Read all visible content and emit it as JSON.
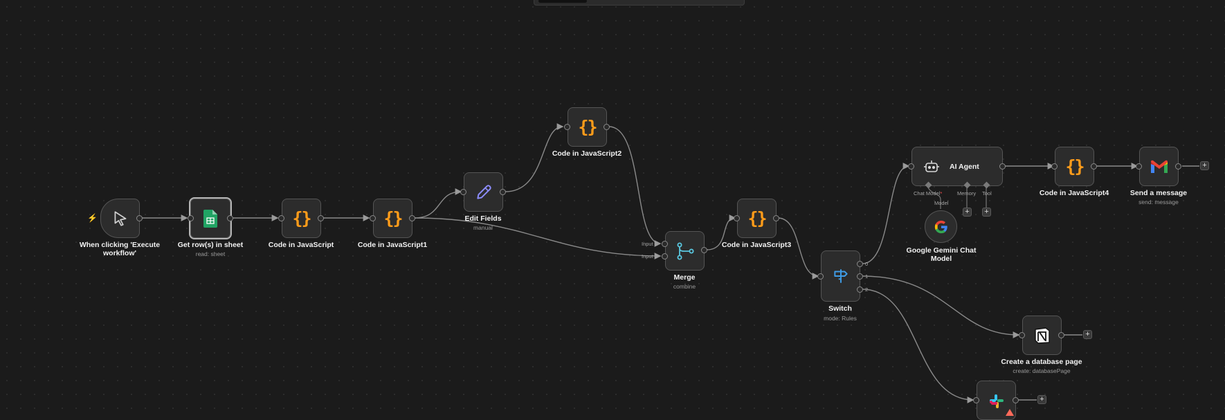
{
  "canvas": {
    "nodes": {
      "trigger": {
        "label": "When clicking 'Execute workflow'"
      },
      "get_rows": {
        "label": "Get row(s) in sheet",
        "sub": "read: sheet"
      },
      "code": {
        "label": "Code in JavaScript"
      },
      "code1": {
        "label": "Code in JavaScript1"
      },
      "edit_fields": {
        "label": "Edit Fields",
        "sub": "manual"
      },
      "code2": {
        "label": "Code in JavaScript2"
      },
      "merge": {
        "label": "Merge",
        "sub": "combine",
        "input1": "Input 1",
        "input2": "Input 2"
      },
      "code3": {
        "label": "Code in JavaScript3"
      },
      "switch": {
        "label": "Switch",
        "sub": "mode: Rules",
        "out0": "0",
        "out1": "1",
        "out2": "2"
      },
      "ai_agent": {
        "label": "AI Agent",
        "chat_model": "Chat Model",
        "memory": "Memory",
        "tool": "Tool",
        "model": "Model"
      },
      "gemini": {
        "label": "Google Gemini Chat Model"
      },
      "code4": {
        "label": "Code in JavaScript4"
      },
      "send_message": {
        "label": "Send a message",
        "sub": "send: message"
      },
      "notion": {
        "label": "Create a database page",
        "sub": "create: databasePage"
      }
    },
    "plus_symbol": "+",
    "colors": {
      "code_icon": "#ff9c1a",
      "sheets_icon": "#21a464",
      "edit_icon": "#8d8dff",
      "merge_icon": "#5ac8e0",
      "switch_icon": "#3f9ce6",
      "required_marker": "#ff4f4f"
    }
  }
}
